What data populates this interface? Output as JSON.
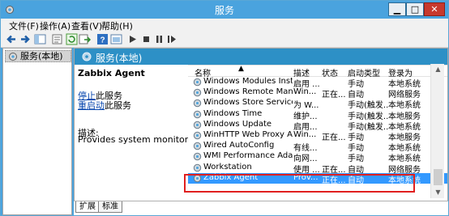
{
  "window": {
    "title": "服务"
  },
  "menubar": {
    "items": [
      "文件(F)",
      "操作(A)",
      "查看(V)",
      "帮助(H)"
    ]
  },
  "toolbar": {
    "icons": [
      "back-arrow-icon",
      "forward-arrow-icon",
      "show-tree-icon",
      "properties-icon",
      "refresh-icon",
      "export-icon",
      "help-icon",
      "console-icon",
      "play-icon",
      "stop-icon",
      "pause-icon",
      "resume-icon"
    ]
  },
  "tree": {
    "root_label": "服务(本地)"
  },
  "panel": {
    "header": "服务(本地)"
  },
  "description": {
    "service_name": "Zabbix Agent",
    "stop_link": "停止",
    "stop_suffix": "此服务",
    "restart_link": "重启动",
    "restart_suffix": "此服务",
    "desc_label": "描述:",
    "desc_text": "Provides system monitoring"
  },
  "list": {
    "columns": {
      "name": "名称",
      "desc": "描述",
      "status": "状态",
      "start_type": "启动类型",
      "logon": "登录为"
    },
    "rows": [
      {
        "name": "Windows Modules Install...",
        "desc": "启用 ...",
        "status": "",
        "start_type": "手动",
        "logon": "本地系统"
      },
      {
        "name": "Windows Remote Manag...",
        "desc": "Win...",
        "status": "正在...",
        "start_type": "自动",
        "logon": "网络服务"
      },
      {
        "name": "Windows Store Service (...",
        "desc": "为 W...",
        "status": "",
        "start_type": "手动(触发...",
        "logon": "本地系统"
      },
      {
        "name": "Windows Time",
        "desc": "维护...",
        "status": "",
        "start_type": "手动(触发...",
        "logon": "本地服务"
      },
      {
        "name": "Windows Update",
        "desc": "启用...",
        "status": "",
        "start_type": "手动(触发...",
        "logon": "本地系统"
      },
      {
        "name": "WinHTTP Web Proxy Aut...",
        "desc": "Win...",
        "status": "正在...",
        "start_type": "手动",
        "logon": "本地服务"
      },
      {
        "name": "Wired AutoConfig",
        "desc": "有线...",
        "status": "",
        "start_type": "手动",
        "logon": "本地系统"
      },
      {
        "name": "WMI Performance Adapt...",
        "desc": "向网...",
        "status": "",
        "start_type": "手动",
        "logon": "本地系统"
      },
      {
        "name": "Workstation",
        "desc": "使用 ...",
        "status": "正在...",
        "start_type": "自动",
        "logon": "网络服务"
      },
      {
        "name": "Zabbix Agent",
        "desc": "Prov...",
        "status": "正在...",
        "start_type": "自动",
        "logon": "本地系统"
      }
    ]
  },
  "tabs": [
    "扩展",
    "标准"
  ],
  "colors": {
    "accent": "#4aa3de",
    "header": "#2d90c6",
    "selection": "#3399ff",
    "highlight": "#e02020"
  }
}
